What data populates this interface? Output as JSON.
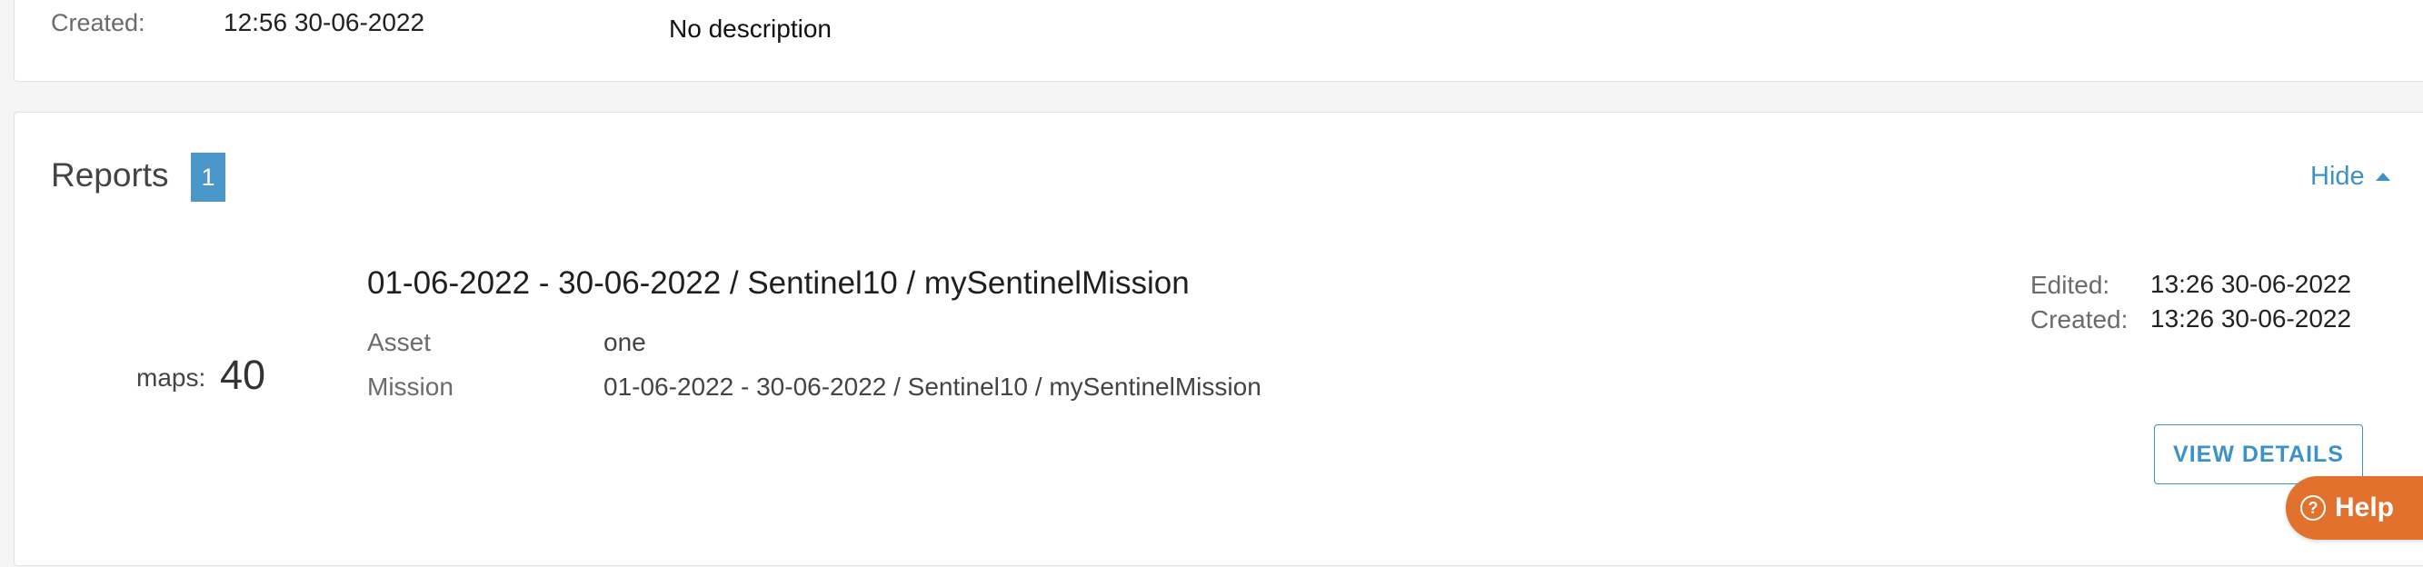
{
  "summary": {
    "created_label": "Created:",
    "created_value": "12:56 30-06-2022",
    "description": "No description"
  },
  "reports": {
    "title": "Reports",
    "count": "1",
    "hide_label": "Hide",
    "item": {
      "maps_label": "maps:",
      "maps_value": "40",
      "title": "01-06-2022 - 30-06-2022 / Sentinel10 / mySentinelMission",
      "asset_label": "Asset",
      "asset_value": "one",
      "mission_label": "Mission",
      "mission_value": "01-06-2022 - 30-06-2022 / Sentinel10 / mySentinelMission",
      "edited_label": "Edited:",
      "edited_value": "13:26 30-06-2022",
      "created_label": "Created:",
      "created_value": "13:26 30-06-2022",
      "view_details_label": "VIEW DETAILS"
    }
  },
  "help": {
    "label": "Help",
    "icon": "question-circle-icon"
  },
  "colors": {
    "accent": "#3d91c9",
    "badge": "#4b97c9",
    "help": "#e2712e"
  }
}
